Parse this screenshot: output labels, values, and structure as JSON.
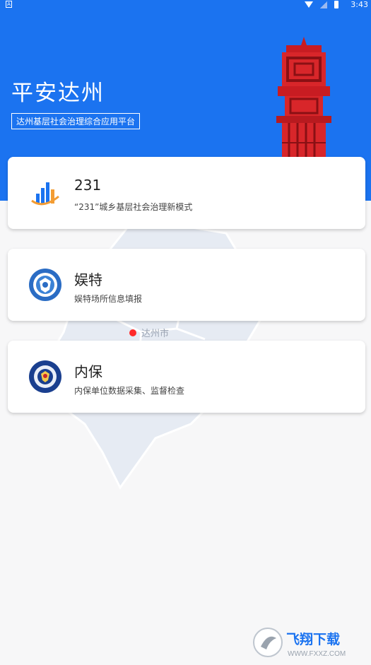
{
  "status_bar": {
    "notification": "A",
    "time": "3:43"
  },
  "header": {
    "title": "平安达州",
    "subtitle": "达州基层社会治理综合应用平台"
  },
  "map": {
    "city_label": "达州市"
  },
  "cards": [
    {
      "title": "231",
      "description": "“231”城乡基层社会治理新模式",
      "icon": "bar-chart-logo-icon"
    },
    {
      "title": "娱特",
      "description": "娱特场所信息填报",
      "icon": "police-emblem-icon"
    },
    {
      "title": "内保",
      "description": "内保单位数据采集、监督检查",
      "icon": "police-emblem-icon"
    }
  ],
  "watermark": {
    "text": "飞翔下载",
    "url": "WWW.FXXZ.COM"
  },
  "colors": {
    "header_blue": "#1b73f0",
    "tower_red": "#d8262a",
    "marker_red": "#ff2a2a"
  }
}
